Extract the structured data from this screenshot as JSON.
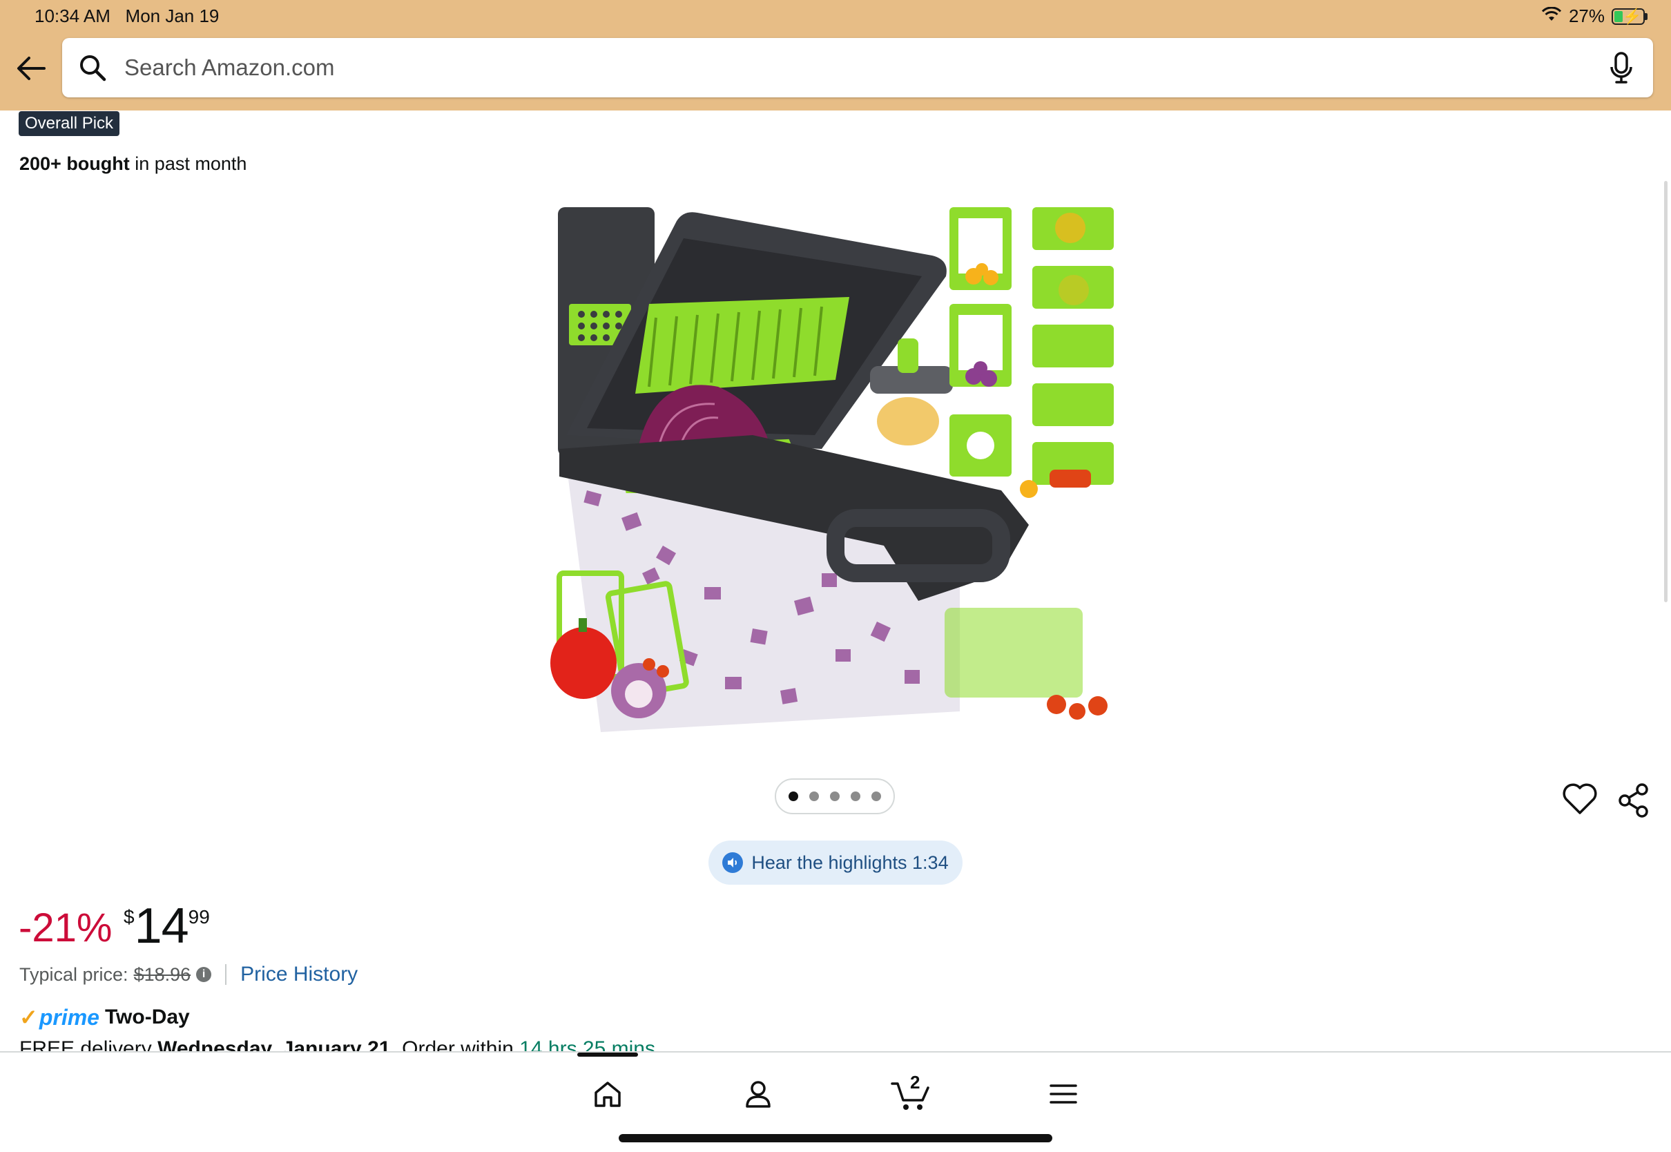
{
  "status_bar": {
    "time": "10:34 AM",
    "date": "Mon Jan 19",
    "battery": "27%",
    "battery_level": 0.27
  },
  "search": {
    "placeholder": "Search Amazon.com",
    "value": ""
  },
  "product": {
    "badge": "Overall Pick",
    "bought_bold": "200+ bought",
    "bought_rest": " in past month",
    "image_count": 5,
    "active_image": 1,
    "highlights_label": "Hear the highlights 1:34"
  },
  "pricing": {
    "discount": "-21%",
    "currency": "$",
    "whole": "14",
    "fraction": "99",
    "typical_label": "Typical price:",
    "typical_value": "$18.96",
    "price_history": "Price History"
  },
  "delivery": {
    "prime": "prime",
    "two_day": "Two-Day",
    "free_delivery": "FREE delivery ",
    "date": "Wednesday, January 21",
    "order_within": ". Order within ",
    "countdown": "14 hrs 25 mins"
  },
  "bottom_nav": {
    "cart_count": "2"
  },
  "colors": {
    "header_bg": "#e7bd86",
    "discount": "#cc0c39",
    "link": "#2162a1",
    "prime": "#1a98ff",
    "countdown": "#067d62"
  }
}
